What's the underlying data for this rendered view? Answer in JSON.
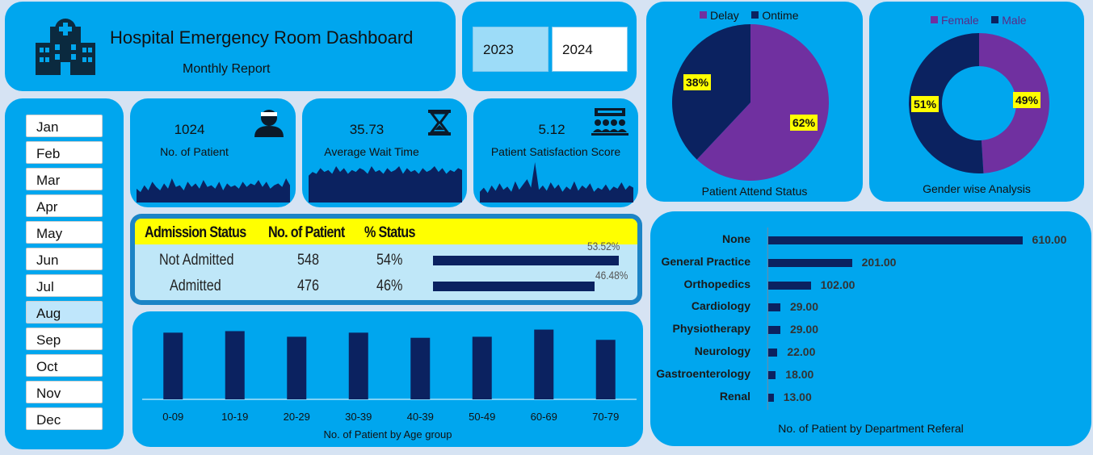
{
  "header": {
    "title": "Hospital Emergency Room Dashboard",
    "subtitle": "Monthly Report",
    "icon": "hospital-icon"
  },
  "years": [
    {
      "label": "2023",
      "selected": true
    },
    {
      "label": "2024",
      "selected": false
    }
  ],
  "months": [
    "Jan",
    "Feb",
    "Mar",
    "Apr",
    "May",
    "Jun",
    "Jul",
    "Aug",
    "Sep",
    "Oct",
    "Nov",
    "Dec"
  ],
  "selected_month": "Aug",
  "kpis": [
    {
      "value": "1024",
      "label": "No. of Patient",
      "icon": "patient-icon",
      "spark": [
        8,
        6,
        10,
        7,
        12,
        9,
        7,
        11,
        8,
        14,
        9,
        10,
        7,
        12,
        9,
        11,
        8,
        13,
        9,
        10,
        8,
        12,
        7,
        11,
        9,
        10,
        8,
        12,
        9,
        11,
        10,
        13,
        9,
        12,
        8,
        10,
        11,
        9,
        14,
        10
      ]
    },
    {
      "value": "35.73",
      "label": "Average Wait Time",
      "icon": "hourglass-icon",
      "spark": [
        14,
        16,
        15,
        18,
        16,
        17,
        15,
        19,
        16,
        18,
        15,
        17,
        16,
        18,
        17,
        15,
        19,
        16,
        17,
        15,
        18,
        16,
        17,
        19,
        15,
        18,
        16,
        17,
        15,
        18,
        16,
        17,
        19,
        16,
        18,
        15,
        17,
        16,
        18,
        17
      ]
    },
    {
      "value": "5.12",
      "label": "Patient Satisfaction Score",
      "icon": "meeting-icon",
      "spark": [
        10,
        14,
        9,
        16,
        11,
        18,
        12,
        15,
        10,
        20,
        12,
        17,
        22,
        14,
        38,
        12,
        16,
        11,
        19,
        13,
        17,
        10,
        15,
        12,
        20,
        11,
        16,
        13,
        18,
        10,
        14,
        12,
        17,
        11,
        15,
        13,
        19,
        12,
        16,
        14
      ]
    }
  ],
  "admission": {
    "headers": [
      "Admission Status",
      "No. of Patient",
      "% Status"
    ],
    "rows": [
      {
        "status": "Not Admitted",
        "count": "548",
        "pct": "54%",
        "bar_label": "53.52%",
        "fraction": 0.5352
      },
      {
        "status": "Admitted",
        "count": "476",
        "pct": "46%",
        "bar_label": "46.48%",
        "fraction": 0.4648
      }
    ]
  },
  "chart_data": [
    {
      "type": "bar",
      "caption": "No. of Patient by Age group",
      "categories": [
        "0-09",
        "10-19",
        "20-29",
        "30-39",
        "40-39",
        "50-49",
        "60-69",
        "70-79"
      ],
      "values": [
        130,
        133,
        122,
        130,
        120,
        122,
        136,
        116
      ],
      "ylim": [
        0,
        140
      ]
    },
    {
      "type": "pie",
      "caption": "Patient Attend Status",
      "legend": [
        "Delay",
        "Ontime"
      ],
      "colors": [
        "#7030a0",
        "#0b2260"
      ],
      "values": [
        62,
        38
      ],
      "labels": [
        "62%",
        "38%"
      ]
    },
    {
      "type": "pie",
      "subtype": "doughnut",
      "caption": "Gender wise Analysis",
      "legend": [
        "Female",
        "Male"
      ],
      "colors": [
        "#7030a0",
        "#0b2260"
      ],
      "values": [
        49,
        51
      ],
      "labels": [
        "49%",
        "51%"
      ]
    },
    {
      "type": "bar",
      "orientation": "horizontal",
      "caption": "No. of Patient by Department Referal",
      "categories": [
        "None",
        "General Practice",
        "Orthopedics",
        "Cardiology",
        "Physiotherapy",
        "Neurology",
        "Gastroenterology",
        "Renal"
      ],
      "values": [
        610,
        201,
        102,
        29,
        29,
        22,
        18,
        13
      ],
      "value_labels": [
        "610.00",
        "201.00",
        "102.00",
        "29.00",
        "29.00",
        "22.00",
        "18.00",
        "13.00"
      ],
      "xlim": [
        0,
        640
      ]
    }
  ]
}
